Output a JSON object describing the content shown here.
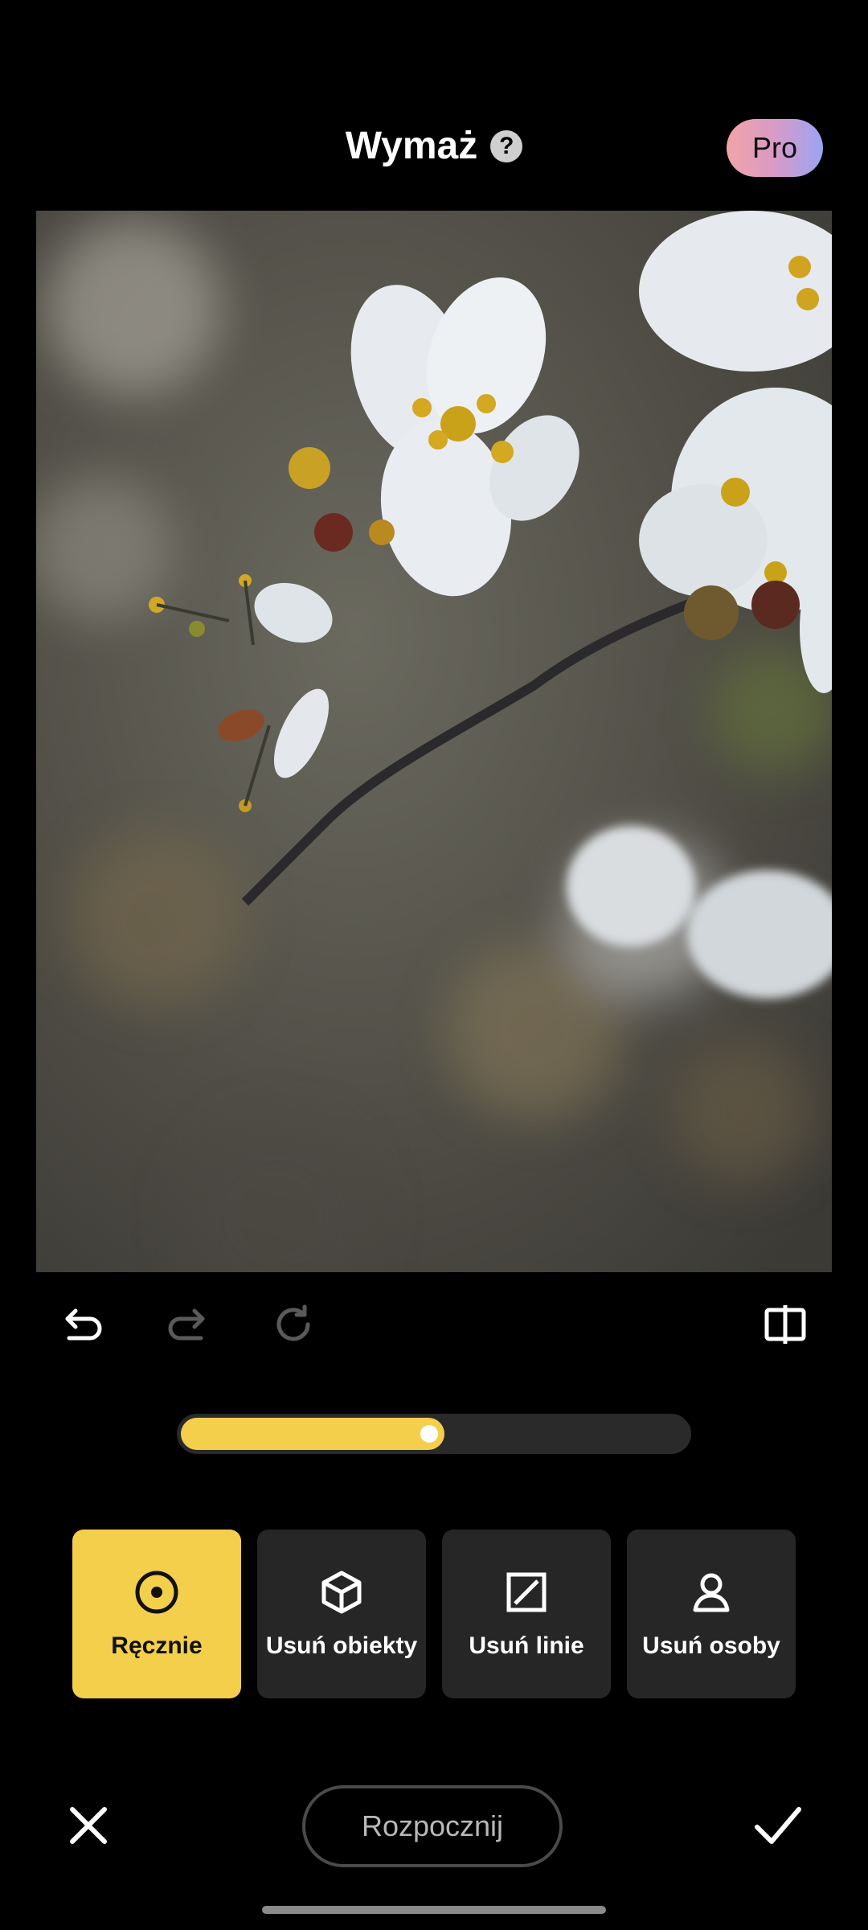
{
  "header": {
    "title": "Wymaż",
    "help_icon": "help-icon",
    "pro_label": "Pro"
  },
  "toolbar": {
    "undo_icon": "undo-icon",
    "redo_icon": "redo-icon",
    "reset_icon": "refresh-icon",
    "compare_icon": "compare-icon"
  },
  "brush_size": {
    "value_fraction": 0.52
  },
  "modes": [
    {
      "label": "Ręcznie",
      "icon": "target-icon",
      "active": true
    },
    {
      "label": "Usuń obiekty",
      "icon": "cube-icon",
      "active": false
    },
    {
      "label": "Usuń linie",
      "icon": "line-erase-icon",
      "active": false
    },
    {
      "label": "Usuń osoby",
      "icon": "person-icon",
      "active": false
    }
  ],
  "bottom": {
    "start_label": "Rozpocznij",
    "close_icon": "close-icon",
    "confirm_icon": "check-icon"
  },
  "colors": {
    "accent": "#f4cf4c",
    "background": "#000000",
    "tile": "#262626"
  }
}
